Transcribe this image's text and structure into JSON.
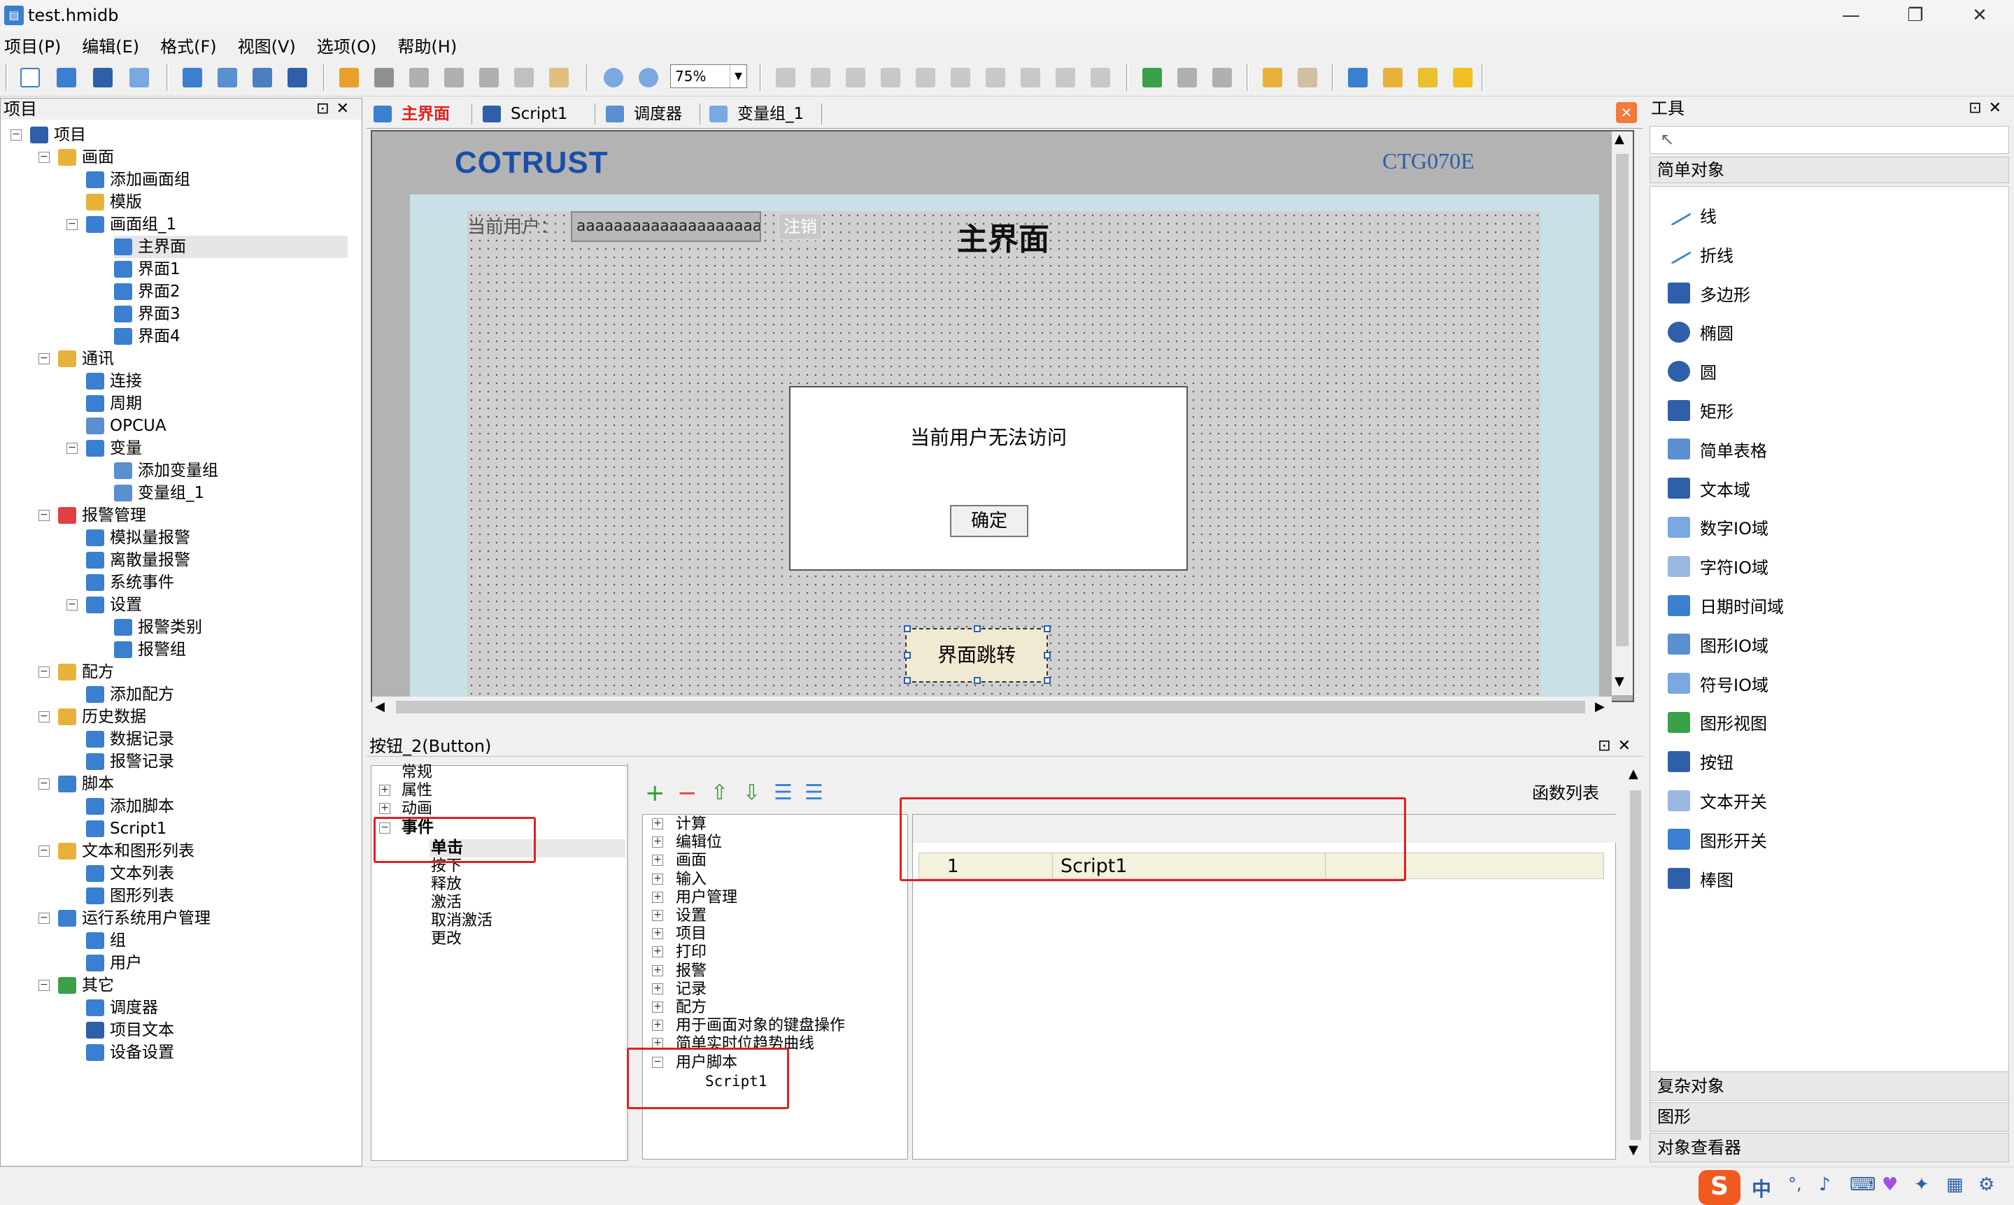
{
  "window": {
    "title": "test.hmidb",
    "minimize": "—",
    "maximize": "❐",
    "close": "✕"
  },
  "menu": [
    "项目(P)",
    "编辑(E)",
    "格式(F)",
    "视图(V)",
    "选项(O)",
    "帮助(H)"
  ],
  "toolbar": {
    "zoom_value": "75%"
  },
  "project_panel": {
    "title": "项目",
    "tree": [
      {
        "label": "项目",
        "level": 0,
        "exp": "minus",
        "icon": "#2e5fa8"
      },
      {
        "label": "画面",
        "level": 1,
        "exp": "minus",
        "icon": "#e8b23a"
      },
      {
        "label": "添加画面组",
        "level": 2,
        "icon": "#3a7fd0"
      },
      {
        "label": "模版",
        "level": 2,
        "icon": "#e8b23a"
      },
      {
        "label": "画面组_1",
        "level": 2,
        "exp": "minus",
        "icon": "#3a7fd0"
      },
      {
        "label": "主界面",
        "level": 3,
        "icon": "#3a7fd0",
        "selected": true
      },
      {
        "label": "界面1",
        "level": 3,
        "icon": "#3a7fd0"
      },
      {
        "label": "界面2",
        "level": 3,
        "icon": "#3a7fd0"
      },
      {
        "label": "界面3",
        "level": 3,
        "icon": "#3a7fd0"
      },
      {
        "label": "界面4",
        "level": 3,
        "icon": "#3a7fd0"
      },
      {
        "label": "通讯",
        "level": 1,
        "exp": "minus",
        "icon": "#e8b23a"
      },
      {
        "label": "连接",
        "level": 2,
        "icon": "#3a7fd0"
      },
      {
        "label": "周期",
        "level": 2,
        "icon": "#3a7fd0"
      },
      {
        "label": "OPCUA",
        "level": 2,
        "icon": "#5a8fd0"
      },
      {
        "label": "变量",
        "level": 2,
        "exp": "minus",
        "icon": "#3a7fd0"
      },
      {
        "label": "添加变量组",
        "level": 3,
        "icon": "#5a8fd0"
      },
      {
        "label": "变量组_1",
        "level": 3,
        "icon": "#5a8fd0"
      },
      {
        "label": "报警管理",
        "level": 1,
        "exp": "minus",
        "icon": "#e04040"
      },
      {
        "label": "模拟量报警",
        "level": 2,
        "icon": "#3a7fd0"
      },
      {
        "label": "离散量报警",
        "level": 2,
        "icon": "#3a7fd0"
      },
      {
        "label": "系统事件",
        "level": 2,
        "icon": "#3a7fd0"
      },
      {
        "label": "设置",
        "level": 2,
        "exp": "minus",
        "icon": "#3a7fd0"
      },
      {
        "label": "报警类别",
        "level": 3,
        "icon": "#3a7fd0"
      },
      {
        "label": "报警组",
        "level": 3,
        "icon": "#3a7fd0"
      },
      {
        "label": "配方",
        "level": 1,
        "exp": "minus",
        "icon": "#e8b23a"
      },
      {
        "label": "添加配方",
        "level": 2,
        "icon": "#3a7fd0"
      },
      {
        "label": "历史数据",
        "level": 1,
        "exp": "minus",
        "icon": "#e8b23a"
      },
      {
        "label": "数据记录",
        "level": 2,
        "icon": "#3a7fd0"
      },
      {
        "label": "报警记录",
        "level": 2,
        "icon": "#3a7fd0"
      },
      {
        "label": "脚本",
        "level": 1,
        "exp": "minus",
        "icon": "#3a7fd0"
      },
      {
        "label": "添加脚本",
        "level": 2,
        "icon": "#3a7fd0"
      },
      {
        "label": "Script1",
        "level": 2,
        "icon": "#3a7fd0"
      },
      {
        "label": "文本和图形列表",
        "level": 1,
        "exp": "minus",
        "icon": "#e8b23a"
      },
      {
        "label": "文本列表",
        "level": 2,
        "icon": "#3a7fd0"
      },
      {
        "label": "图形列表",
        "level": 2,
        "icon": "#3a7fd0"
      },
      {
        "label": "运行系统用户管理",
        "level": 1,
        "exp": "minus",
        "icon": "#3a7fd0"
      },
      {
        "label": "组",
        "level": 2,
        "icon": "#3a7fd0"
      },
      {
        "label": "用户",
        "level": 2,
        "icon": "#3a7fd0"
      },
      {
        "label": "其它",
        "level": 1,
        "exp": "minus",
        "icon": "#3aa04a"
      },
      {
        "label": "调度器",
        "level": 2,
        "icon": "#3a7fd0"
      },
      {
        "label": "项目文本",
        "level": 2,
        "icon": "#2e5fa8"
      },
      {
        "label": "设备设置",
        "level": 2,
        "icon": "#3a7fd0"
      }
    ]
  },
  "tabs": [
    {
      "label": "主界面",
      "active": true
    },
    {
      "label": "Script1"
    },
    {
      "label": "调度器"
    },
    {
      "label": "变量组_1"
    }
  ],
  "canvas": {
    "brand": "COTRUST",
    "model": "CTG070E",
    "user_label": "当前用户：",
    "user_value": "aaaaaaaaaaaaaaaaaaaa",
    "logout": "注销",
    "title": "主界面",
    "dialog_message": "当前用户无法访问",
    "dialog_ok": "确定",
    "jump_button": "界面跳转"
  },
  "properties": {
    "title": "按钮_2(Button)",
    "categories": [
      "常规",
      "属性",
      "动画",
      "事件"
    ],
    "events": [
      "单击",
      "按下",
      "释放",
      "激活",
      "取消激活",
      "更改"
    ],
    "function_list_label": "函数列表",
    "functions": [
      "计算",
      "编辑位",
      "画面",
      "输入",
      "用户管理",
      "设置",
      "项目",
      "打印",
      "报警",
      "记录",
      "配方",
      "用于画面对象的键盘操作",
      "简单实时位趋势曲线",
      "用户脚本"
    ],
    "user_script_child": "Script1",
    "grid_row": {
      "index": "1",
      "name": "Script1"
    }
  },
  "tools": {
    "title": "工具",
    "section_simple": "简单对象",
    "items": [
      {
        "label": "线",
        "icon": "line-icon"
      },
      {
        "label": "折线",
        "icon": "polyline-icon"
      },
      {
        "label": "多边形",
        "icon": "polygon-icon"
      },
      {
        "label": "椭圆",
        "icon": "ellipse-icon"
      },
      {
        "label": "圆",
        "icon": "circle-icon"
      },
      {
        "label": "矩形",
        "icon": "rectangle-icon"
      },
      {
        "label": "简单表格",
        "icon": "table-icon"
      },
      {
        "label": "文本域",
        "icon": "text-field-icon"
      },
      {
        "label": "数字IO域",
        "icon": "numeric-io-icon"
      },
      {
        "label": "字符IO域",
        "icon": "char-io-icon"
      },
      {
        "label": "日期时间域",
        "icon": "datetime-icon"
      },
      {
        "label": "图形IO域",
        "icon": "graphic-io-icon"
      },
      {
        "label": "符号IO域",
        "icon": "symbol-io-icon"
      },
      {
        "label": "图形视图",
        "icon": "graphic-view-icon"
      },
      {
        "label": "按钮",
        "icon": "button-icon"
      },
      {
        "label": "文本开关",
        "icon": "text-switch-icon"
      },
      {
        "label": "图形开关",
        "icon": "graphic-switch-icon"
      },
      {
        "label": "棒图",
        "icon": "bar-graph-icon"
      }
    ],
    "section_complex": "复杂对象",
    "section_graphics": "图形",
    "section_inspector": "对象查看器"
  },
  "tray": {
    "ime": "中"
  }
}
